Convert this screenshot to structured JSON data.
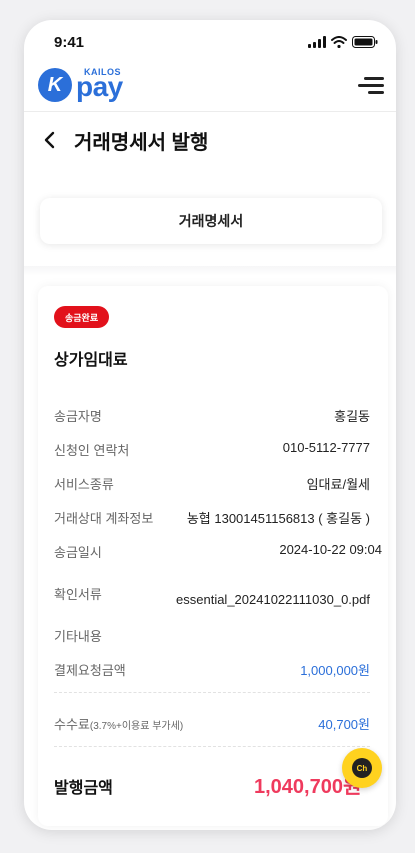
{
  "status_bar": {
    "time": "9:41"
  },
  "header": {
    "logo_small": "KAILOS",
    "logo_big": "pay",
    "logo_mark": "K"
  },
  "page": {
    "title": "거래명세서 발행"
  },
  "tab": {
    "label": "거래명세서"
  },
  "detail": {
    "badge": "송금완료",
    "title": "상가임대료",
    "rows": [
      {
        "label": "송금자명",
        "value": "홍길동"
      },
      {
        "label": "신청인 연락처",
        "value": "010-5112-7777"
      },
      {
        "label": "서비스종류",
        "value": "임대료/월세"
      },
      {
        "label": "거래상대 계좌정보",
        "value": "농협 13001451156813 ( 홍길동 )"
      },
      {
        "label": "송금일시",
        "value": "2024-10-22 09:04"
      },
      {
        "label": "확인서류",
        "value": "essential_20241022111030_0.pdf"
      },
      {
        "label": "기타내용",
        "value": ""
      },
      {
        "label": "결제요청금액",
        "value": "1,000,000원"
      }
    ],
    "fee": {
      "label": "수수료",
      "note": "(3.7%+이용료 부가세)",
      "value": "40,700원"
    },
    "total": {
      "label": "발행금액",
      "value": "1,040,700원"
    }
  },
  "chat": {
    "label": "Ch"
  },
  "colors": {
    "brand": "#2b6fd9",
    "badge": "#e2111b",
    "total": "#ef3a5d",
    "chat": "#ffd21f"
  }
}
